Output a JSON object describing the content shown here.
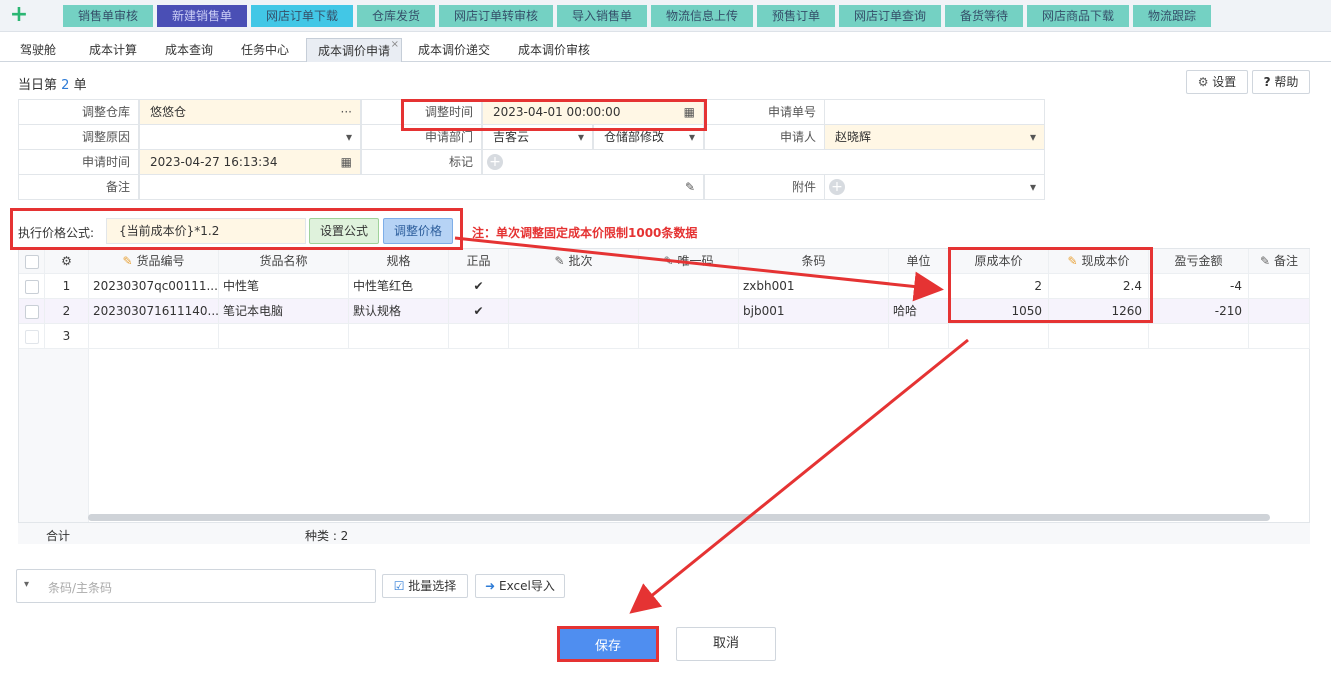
{
  "topbar": {
    "buttons": [
      {
        "label": "销售单审核",
        "bg": "#74d1c3"
      },
      {
        "label": "新建销售单",
        "bg": "#4a4fb5",
        "fg": "#c9ccf5"
      },
      {
        "label": "网店订单下载",
        "bg": "#42c7e6"
      },
      {
        "label": "仓库发货",
        "bg": "#74d1c3"
      },
      {
        "label": "网店订单转审核",
        "bg": "#74d1c3"
      },
      {
        "label": "导入销售单",
        "bg": "#74d1c3"
      },
      {
        "label": "物流信息上传",
        "bg": "#74d1c3"
      },
      {
        "label": "预售订单",
        "bg": "#74d1c3"
      },
      {
        "label": "网店订单查询",
        "bg": "#74d1c3"
      },
      {
        "label": "备货等待",
        "bg": "#74d1c3"
      },
      {
        "label": "网店商品下载",
        "bg": "#74d1c3"
      },
      {
        "label": "物流跟踪",
        "bg": "#74d1c3"
      }
    ]
  },
  "tabs": [
    {
      "label": "驾驶舱"
    },
    {
      "label": "成本计算"
    },
    {
      "label": "成本查询"
    },
    {
      "label": "任务中心"
    },
    {
      "label": "成本调价申请",
      "active": true
    },
    {
      "label": "成本调价递交"
    },
    {
      "label": "成本调价审核"
    }
  ],
  "heading": {
    "prefix": "当日第",
    "num": "2",
    "suffix": "单"
  },
  "header_buttons": {
    "settings": "设置",
    "help": "帮助"
  },
  "form": {
    "warehouse_label": "调整仓库",
    "warehouse_value": "悠悠仓",
    "time_label": "调整时间",
    "time_value": "2023-04-01 00:00:00",
    "order_no_label": "申请单号",
    "order_no_value": "",
    "reason_label": "调整原因",
    "reason_value": "",
    "dept_label": "申请部门",
    "dept_value1": "吉客云",
    "dept_value2": "仓储部修改",
    "applicant_label": "申请人",
    "applicant_value": "赵晓辉",
    "apply_time_label": "申请时间",
    "apply_time_value": "2023-04-27 16:13:34",
    "mark_label": "标记",
    "remark_label": "备注",
    "remark_value": "",
    "attach_label": "附件"
  },
  "formula": {
    "label": "执行价格公式:",
    "value": "{当前成本价}*1.2",
    "set_btn": "设置公式",
    "adjust_btn": "调整价格",
    "note": "注：单次调整固定成本价限制1000条数据"
  },
  "grid": {
    "headers": [
      "货品编号",
      "货品名称",
      "规格",
      "正品",
      "批次",
      "唯一码",
      "条码",
      "单位",
      "原成本价",
      "现成本价",
      "盈亏金额",
      "备注"
    ],
    "rows": [
      {
        "no": "1",
        "code": "20230307qc00111...",
        "name": "中性笔",
        "spec": "中性笔红色",
        "genuine": "✔",
        "batch": "",
        "unique": "",
        "barcode": "zxbh001",
        "unit": "",
        "orig": "2",
        "now": "2.4",
        "diff": "-4"
      },
      {
        "no": "2",
        "code": "202303071611140...",
        "name": "笔记本电脑",
        "spec": "默认规格",
        "genuine": "✔",
        "batch": "",
        "unique": "",
        "barcode": "bjb001",
        "unit": "哈哈",
        "orig": "1050",
        "now": "1260",
        "diff": "-210"
      },
      {
        "no": "3",
        "code": "",
        "name": "",
        "spec": "",
        "genuine": "",
        "batch": "",
        "unique": "",
        "barcode": "",
        "unit": "",
        "orig": "",
        "now": "",
        "diff": ""
      }
    ],
    "footer_total": "合计",
    "footer_kinds": "种类 : 2"
  },
  "bottom": {
    "barcode_placeholder": "条码/主条码",
    "batch_select": "批量选择",
    "excel_import": "Excel导入",
    "save": "保存",
    "cancel": "取消"
  },
  "colors": {
    "accent": "#4f8ef0",
    "highlight": "#e53333",
    "field_bg": "#fff7e5"
  }
}
